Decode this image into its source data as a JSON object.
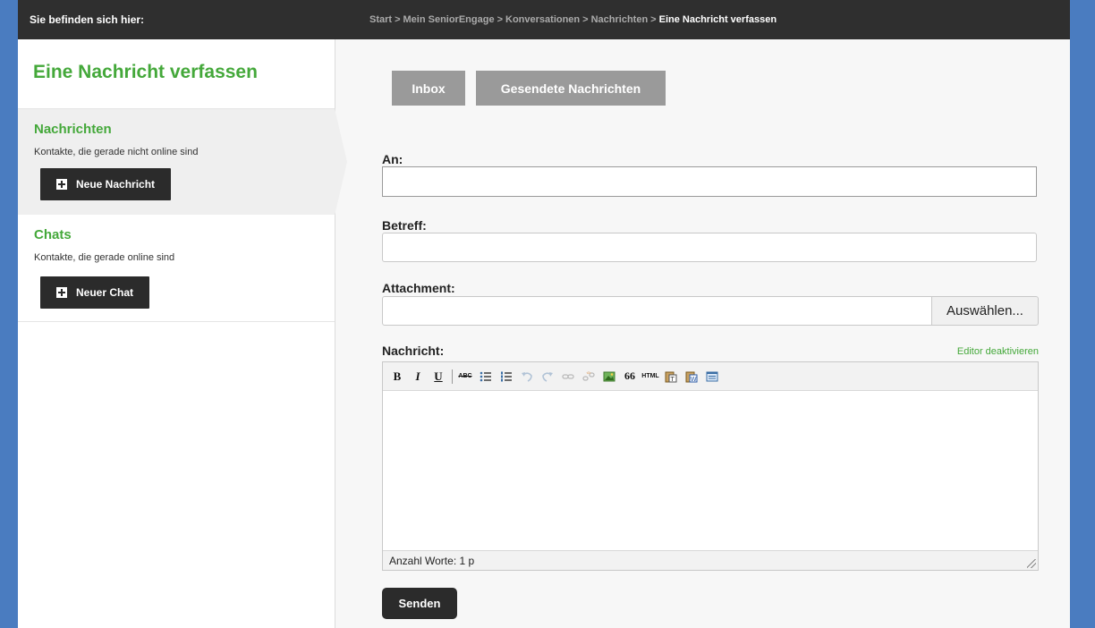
{
  "topbar": {
    "here_label": "Sie befinden sich hier:",
    "breadcrumb": {
      "items": [
        "Start",
        "Mein SeniorEngage",
        "Konversationen",
        "Nachrichten"
      ],
      "separator": ">",
      "current": "Eine Nachricht verfassen"
    }
  },
  "sidebar": {
    "title": "Eine Nachricht verfassen",
    "sections": [
      {
        "title": "Nachrichten",
        "description": "Kontakte, die gerade nicht online sind",
        "button": "Neue Nachricht"
      },
      {
        "title": "Chats",
        "description": "Kontakte, die gerade online sind",
        "button": "Neuer Chat"
      }
    ]
  },
  "tabs": {
    "inbox": "Inbox",
    "sent": "Gesendete Nachrichten"
  },
  "form": {
    "to_label": "An:",
    "to_value": "",
    "subject_label": "Betreff:",
    "subject_value": "",
    "attachment_label": "Attachment:",
    "attachment_value": "",
    "browse_label": "Auswählen...",
    "message_label": "Nachricht:",
    "editor_toggle": "Editor deaktivieren",
    "word_count": "Anzahl Worte: 1 p",
    "send_label": "Senden"
  },
  "toolbar": {
    "bold": "B",
    "italic": "I",
    "underline": "U",
    "strike": "ABC",
    "html": "HTML",
    "quote": "66"
  },
  "colors": {
    "accent_green": "#44a83a",
    "topbar": "#2f2f2f",
    "page_border": "#4a7cc0",
    "tab_gray": "#9a9a9a",
    "dark_button": "#2b2b2b"
  }
}
